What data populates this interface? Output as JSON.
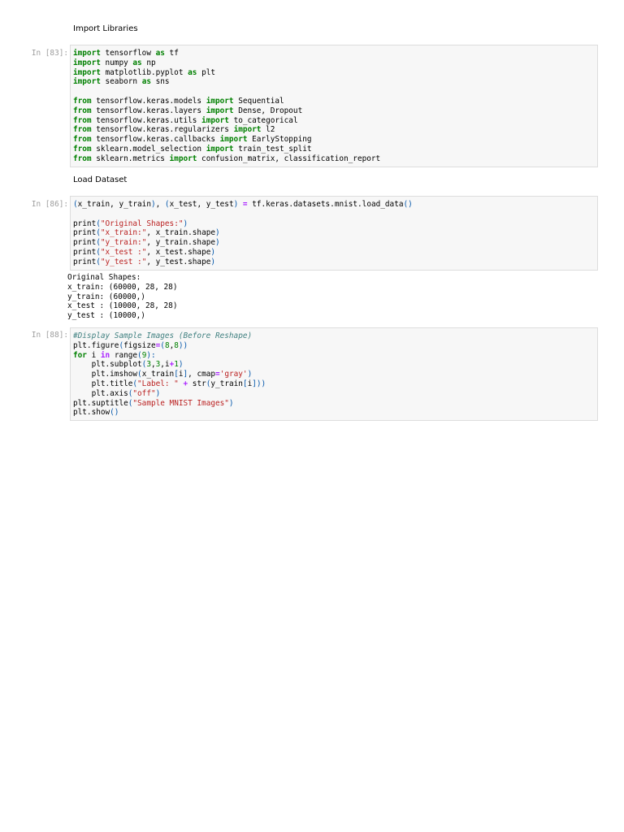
{
  "sections": {
    "import_heading": "Import Libraries",
    "load_heading": "Load Dataset"
  },
  "cells": [
    {
      "prompt": "In [83]:",
      "lines": [
        [
          [
            "kw",
            "import"
          ],
          [
            "t",
            " tensorflow "
          ],
          [
            "kw",
            "as"
          ],
          [
            "t",
            " tf"
          ]
        ],
        [
          [
            "kw",
            "import"
          ],
          [
            "t",
            " numpy "
          ],
          [
            "kw",
            "as"
          ],
          [
            "t",
            " np"
          ]
        ],
        [
          [
            "kw",
            "import"
          ],
          [
            "t",
            " matplotlib.pyplot "
          ],
          [
            "kw",
            "as"
          ],
          [
            "t",
            " plt"
          ]
        ],
        [
          [
            "kw",
            "import"
          ],
          [
            "t",
            " seaborn "
          ],
          [
            "kw",
            "as"
          ],
          [
            "t",
            " sns"
          ]
        ],
        [],
        [
          [
            "kw",
            "from"
          ],
          [
            "t",
            " tensorflow.keras.models "
          ],
          [
            "kw",
            "import"
          ],
          [
            "t",
            " Sequential"
          ]
        ],
        [
          [
            "kw",
            "from"
          ],
          [
            "t",
            " tensorflow.keras.layers "
          ],
          [
            "kw",
            "import"
          ],
          [
            "t",
            " Dense, Dropout"
          ]
        ],
        [
          [
            "kw",
            "from"
          ],
          [
            "t",
            " tensorflow.keras.utils "
          ],
          [
            "kw",
            "import"
          ],
          [
            "t",
            " to_categorical"
          ]
        ],
        [
          [
            "kw",
            "from"
          ],
          [
            "t",
            " tensorflow.keras.regularizers "
          ],
          [
            "kw",
            "import"
          ],
          [
            "t",
            " l2"
          ]
        ],
        [
          [
            "kw",
            "from"
          ],
          [
            "t",
            " tensorflow.keras.callbacks "
          ],
          [
            "kw",
            "import"
          ],
          [
            "t",
            " EarlyStopping"
          ]
        ],
        [
          [
            "kw",
            "from"
          ],
          [
            "t",
            " sklearn.model_selection "
          ],
          [
            "kw",
            "import"
          ],
          [
            "t",
            " train_test_split"
          ]
        ],
        [
          [
            "kw",
            "from"
          ],
          [
            "t",
            " sklearn.metrics "
          ],
          [
            "kw",
            "import"
          ],
          [
            "t",
            " confusion_matrix, classification_report"
          ]
        ]
      ]
    },
    {
      "prompt": "In [86]:",
      "lines": [
        [
          [
            "par",
            "("
          ],
          [
            "t",
            "x_train, y_train"
          ],
          [
            "par",
            ")"
          ],
          [
            "t",
            ", "
          ],
          [
            "par",
            "("
          ],
          [
            "t",
            "x_test, y_test"
          ],
          [
            "par",
            ")"
          ],
          [
            "t",
            " "
          ],
          [
            "op",
            "="
          ],
          [
            "t",
            " tf.keras.datasets.mnist.load_data"
          ],
          [
            "par",
            "()"
          ]
        ],
        [],
        [
          [
            "t",
            "print"
          ],
          [
            "par",
            "("
          ],
          [
            "str",
            "\"Original Shapes:\""
          ],
          [
            "par",
            ")"
          ]
        ],
        [
          [
            "t",
            "print"
          ],
          [
            "par",
            "("
          ],
          [
            "str",
            "\"x_train:\""
          ],
          [
            "t",
            ", x_train.shape"
          ],
          [
            "par",
            ")"
          ]
        ],
        [
          [
            "t",
            "print"
          ],
          [
            "par",
            "("
          ],
          [
            "str",
            "\"y_train:\""
          ],
          [
            "t",
            ", y_train.shape"
          ],
          [
            "par",
            ")"
          ]
        ],
        [
          [
            "t",
            "print"
          ],
          [
            "par",
            "("
          ],
          [
            "str",
            "\"x_test :\""
          ],
          [
            "t",
            ", x_test.shape"
          ],
          [
            "par",
            ")"
          ]
        ],
        [
          [
            "t",
            "print"
          ],
          [
            "par",
            "("
          ],
          [
            "str",
            "\"y_test :\""
          ],
          [
            "t",
            ", y_test.shape"
          ],
          [
            "par",
            ")"
          ]
        ]
      ],
      "output": [
        "Original Shapes:",
        "x_train: (60000, 28, 28)",
        "y_train: (60000,)",
        "x_test : (10000, 28, 28)",
        "y_test : (10000,)"
      ]
    },
    {
      "prompt": "In [88]:",
      "lines": [
        [
          [
            "cm",
            "#Display Sample Images (Before Reshape)"
          ]
        ],
        [
          [
            "t",
            "plt.figure"
          ],
          [
            "par",
            "("
          ],
          [
            "t",
            "figsize"
          ],
          [
            "op",
            "="
          ],
          [
            "par",
            "("
          ],
          [
            "num",
            "8"
          ],
          [
            "t",
            ","
          ],
          [
            "num",
            "8"
          ],
          [
            "par",
            "))"
          ]
        ],
        [
          [
            "kw",
            "for"
          ],
          [
            "t",
            " i "
          ],
          [
            "op",
            "in"
          ],
          [
            "t",
            " range"
          ],
          [
            "par",
            "("
          ],
          [
            "num",
            "9"
          ],
          [
            "par",
            "):"
          ]
        ],
        [
          [
            "t",
            "    plt.subplot"
          ],
          [
            "par",
            "("
          ],
          [
            "num",
            "3"
          ],
          [
            "t",
            ","
          ],
          [
            "num",
            "3"
          ],
          [
            "t",
            ",i"
          ],
          [
            "op",
            "+"
          ],
          [
            "num",
            "1"
          ],
          [
            "par",
            ")"
          ]
        ],
        [
          [
            "t",
            "    plt.imshow"
          ],
          [
            "par",
            "("
          ],
          [
            "t",
            "x_train"
          ],
          [
            "par",
            "["
          ],
          [
            "t",
            "i"
          ],
          [
            "par",
            "]"
          ],
          [
            "t",
            ", cmap"
          ],
          [
            "op",
            "="
          ],
          [
            "str",
            "'gray'"
          ],
          [
            "par",
            ")"
          ]
        ],
        [
          [
            "t",
            "    plt.title"
          ],
          [
            "par",
            "("
          ],
          [
            "str",
            "\"Label: \""
          ],
          [
            "t",
            " "
          ],
          [
            "op",
            "+"
          ],
          [
            "t",
            " str"
          ],
          [
            "par",
            "("
          ],
          [
            "t",
            "y_train"
          ],
          [
            "par",
            "["
          ],
          [
            "t",
            "i"
          ],
          [
            "par",
            "]))"
          ]
        ],
        [
          [
            "t",
            "    plt.axis"
          ],
          [
            "par",
            "("
          ],
          [
            "str",
            "\"off\""
          ],
          [
            "par",
            ")"
          ]
        ],
        [
          [
            "t",
            "plt.suptitle"
          ],
          [
            "par",
            "("
          ],
          [
            "str",
            "\"Sample MNIST Images\""
          ],
          [
            "par",
            ")"
          ]
        ],
        [
          [
            "t",
            "plt.show"
          ],
          [
            "par",
            "()"
          ]
        ]
      ]
    }
  ]
}
